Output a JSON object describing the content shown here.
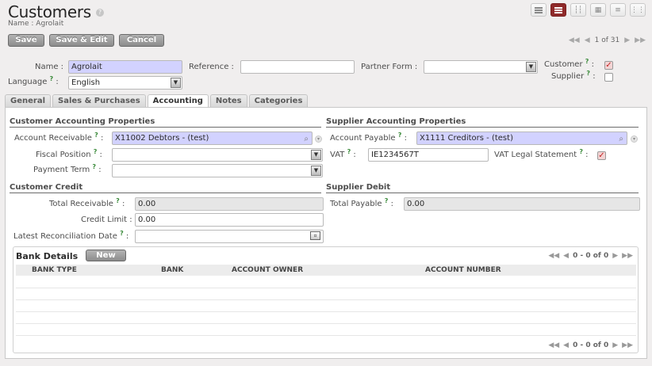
{
  "header": {
    "title": "Customers",
    "help": "?",
    "subtitle": "Name : Agrolait"
  },
  "toolbar": {
    "save": "Save",
    "save_edit": "Save & Edit",
    "cancel": "Cancel"
  },
  "pager": {
    "first": "◀◀",
    "prev": "◀",
    "text": "1 of 31",
    "next": "▶",
    "last": "▶▶"
  },
  "form": {
    "name_label": "Name :",
    "name_value": "Agrolait",
    "reference_label": "Reference :",
    "reference_value": "",
    "partner_form_label": "Partner Form :",
    "partner_form_value": "",
    "language_label": "Language",
    "language_value": "English",
    "customer_label": "Customer",
    "customer_checked": true,
    "supplier_label": "Supplier",
    "supplier_checked": false,
    "help_mark": "?"
  },
  "tabs": [
    "General",
    "Sales & Purchases",
    "Accounting",
    "Notes",
    "Categories"
  ],
  "accounting": {
    "customer_props": "Customer Accounting Properties",
    "supplier_props": "Supplier Accounting Properties",
    "account_receivable_label": "Account Receivable",
    "account_receivable_value": "X11002 Debtors - (test)",
    "fiscal_position_label": "Fiscal Position",
    "fiscal_position_value": "",
    "payment_term_label": "Payment Term",
    "payment_term_value": "",
    "account_payable_label": "Account Payable",
    "account_payable_value": "X1111 Creditors - (test)",
    "vat_label": "VAT",
    "vat_value": "IE1234567T",
    "vat_legal_label": "VAT Legal Statement",
    "vat_legal_checked": true,
    "customer_credit": "Customer Credit",
    "supplier_debit": "Supplier Debit",
    "total_receivable_label": "Total Receivable",
    "total_receivable_value": "0.00",
    "credit_limit_label": "Credit Limit :",
    "credit_limit_value": "0.00",
    "latest_recon_label": "Latest Reconciliation Date",
    "latest_recon_value": "",
    "total_payable_label": "Total Payable",
    "total_payable_value": "0.00"
  },
  "bank": {
    "title": "Bank Details",
    "new": "New",
    "pager_text": "0 - 0 of 0",
    "columns": [
      "BANK TYPE",
      "BANK",
      "ACCOUNT OWNER",
      "ACCOUNT NUMBER"
    ]
  }
}
